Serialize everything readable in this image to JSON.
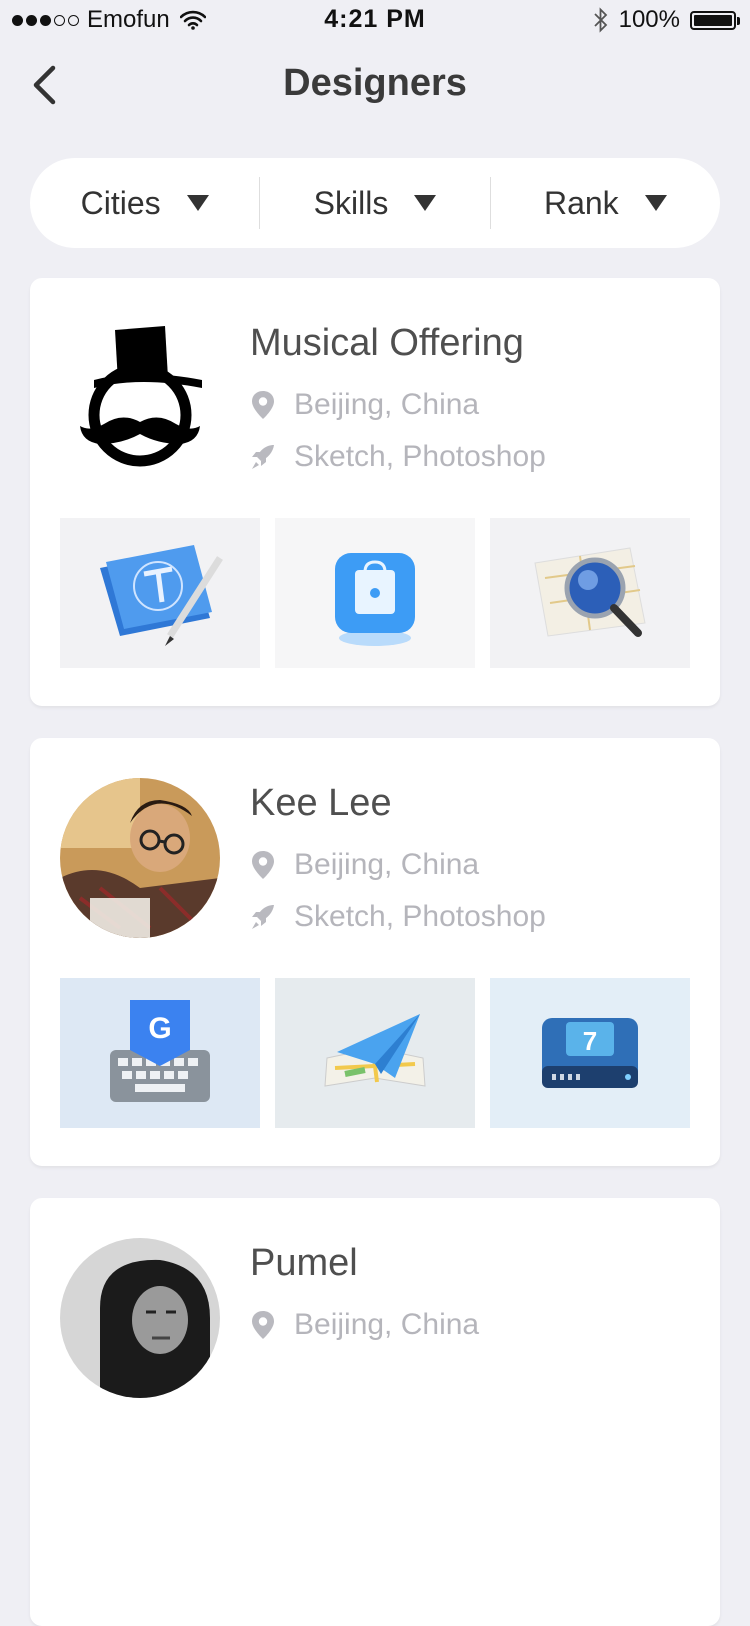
{
  "status_bar": {
    "carrier": "Emofun",
    "time": "4:21 PM",
    "battery": "100%"
  },
  "nav": {
    "title": "Designers"
  },
  "filters": [
    {
      "label": "Cities"
    },
    {
      "label": "Skills"
    },
    {
      "label": "Rank"
    }
  ],
  "designers": [
    {
      "name": "Musical Offering",
      "location": "Beijing, China",
      "skills": "Sketch, Photoshop",
      "works": [
        "blueprint-tool-app-icon",
        "app-store-bag-icon",
        "map-magnifier-icon"
      ]
    },
    {
      "name": "Kee Lee",
      "location": "Beijing, China",
      "skills": "Sketch, Photoshop",
      "works": [
        "google-keyboard-icon",
        "paper-plane-map-icon",
        "blue-drive-icon"
      ]
    },
    {
      "name": "Pumel",
      "location": "Beijing, China",
      "skills": "",
      "works": []
    }
  ],
  "colors": {
    "background": "#efeff4",
    "card": "#ffffff",
    "meta_text": "#b5b5bb",
    "name_text": "#4f4f4f"
  }
}
